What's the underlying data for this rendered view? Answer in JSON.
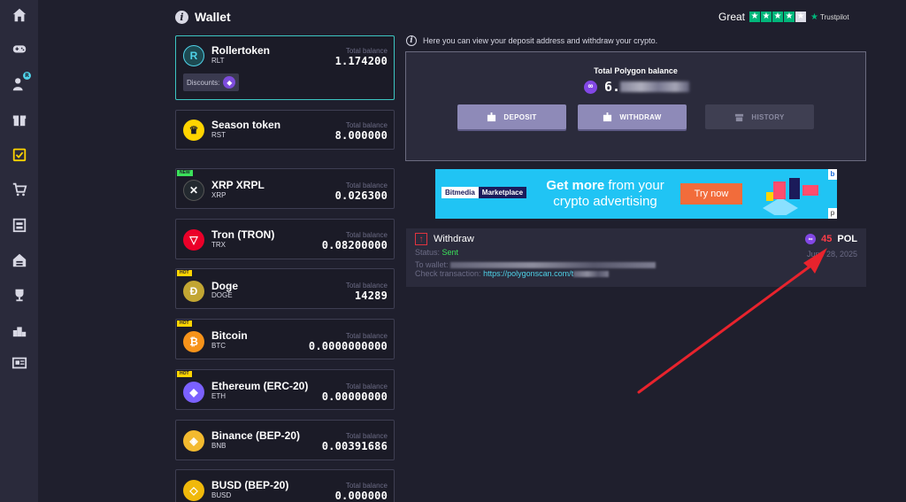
{
  "nav": {
    "items": [
      {
        "name": "home-icon"
      },
      {
        "name": "gamepad-icon"
      },
      {
        "name": "user-money-icon",
        "badge": "R"
      },
      {
        "name": "gift-icon"
      },
      {
        "name": "tasks-icon"
      },
      {
        "name": "cart-icon"
      },
      {
        "name": "store-icon"
      },
      {
        "name": "house-icon"
      },
      {
        "name": "trophy-icon"
      },
      {
        "name": "podium-icon"
      },
      {
        "name": "news-icon"
      }
    ],
    "active_color": "#ffd400",
    "icon_color": "#d8d8e4"
  },
  "header": {
    "title": "Wallet",
    "info_glyph": "i"
  },
  "trustpilot": {
    "rating_label": "Great",
    "stars_filled": 4,
    "stars_total": 5,
    "brand": "Trustpilot"
  },
  "balance_label": "Total balance",
  "tokens": [
    {
      "name": "Rollertoken",
      "symbol": "RLT",
      "balance": "1.174200",
      "icon_color": "#1d4a52",
      "glyph": "R",
      "active": true,
      "discount_label": "Discounts:"
    },
    {
      "name": "Season token",
      "symbol": "RST",
      "balance": "8.000000",
      "icon_color": "#ffd400",
      "glyph": "♛"
    },
    {
      "name": "XRP XRPL",
      "symbol": "XRP",
      "balance": "0.026300",
      "icon_color": "#23292f",
      "glyph": "✕",
      "tag": "NEW"
    },
    {
      "name": "Tron (TRON)",
      "symbol": "TRX",
      "balance": "0.08200000",
      "icon_color": "#eb0029",
      "glyph": "▽"
    },
    {
      "name": "Doge",
      "symbol": "DOGE",
      "balance": "14289",
      "icon_color": "#c2a633",
      "glyph": "Ð",
      "tag": "HOT"
    },
    {
      "name": "Bitcoin",
      "symbol": "BTC",
      "balance": "0.0000000000",
      "icon_color": "#f7931a",
      "glyph": "₿",
      "tag": "HOT"
    },
    {
      "name": "Ethereum (ERC-20)",
      "symbol": "ETH",
      "balance": "0.00000000",
      "icon_color": "#7b61ff",
      "glyph": "◆",
      "tag": "HOT"
    },
    {
      "name": "Binance (BEP-20)",
      "symbol": "BNB",
      "balance": "0.00391686",
      "icon_color": "#f3ba2f",
      "glyph": "◈"
    },
    {
      "name": "BUSD (BEP-20)",
      "symbol": "BUSD",
      "balance": "0.000000",
      "icon_color": "#f0b90b",
      "glyph": "◇"
    }
  ],
  "info_text": "Here you can view your deposit address and withdraw your crypto.",
  "polygon": {
    "label": "Total Polygon balance",
    "value_visible": "6.",
    "buttons": {
      "deposit": "DEPOSIT",
      "withdraw": "WITHDRAW",
      "history": "HISTORY"
    }
  },
  "ad": {
    "logo_part1": "Bitmedia",
    "logo_part2": "Marketplace",
    "headline_bold": "Get more",
    "headline_rest": " from your",
    "headline_line2": "crypto advertising",
    "cta": "Try now",
    "corner_top": "b",
    "corner_bottom": "p"
  },
  "record": {
    "title": "Withdraw",
    "amount": "45",
    "currency": "POL",
    "status_label": "Status:",
    "status_value": "Sent",
    "wallet_label": "To wallet:",
    "check_label": "Check transaction:",
    "check_link": "https://polygonscan.com/t",
    "date": "June 28, 2025",
    "arrow_glyph": "↑"
  },
  "colors": {
    "accent_teal": "#3cc6c2",
    "amount_red": "#ff3d48",
    "status_green": "#3be05a",
    "link_cyan": "#4fd2e8",
    "annotation_red": "#e8232d"
  }
}
